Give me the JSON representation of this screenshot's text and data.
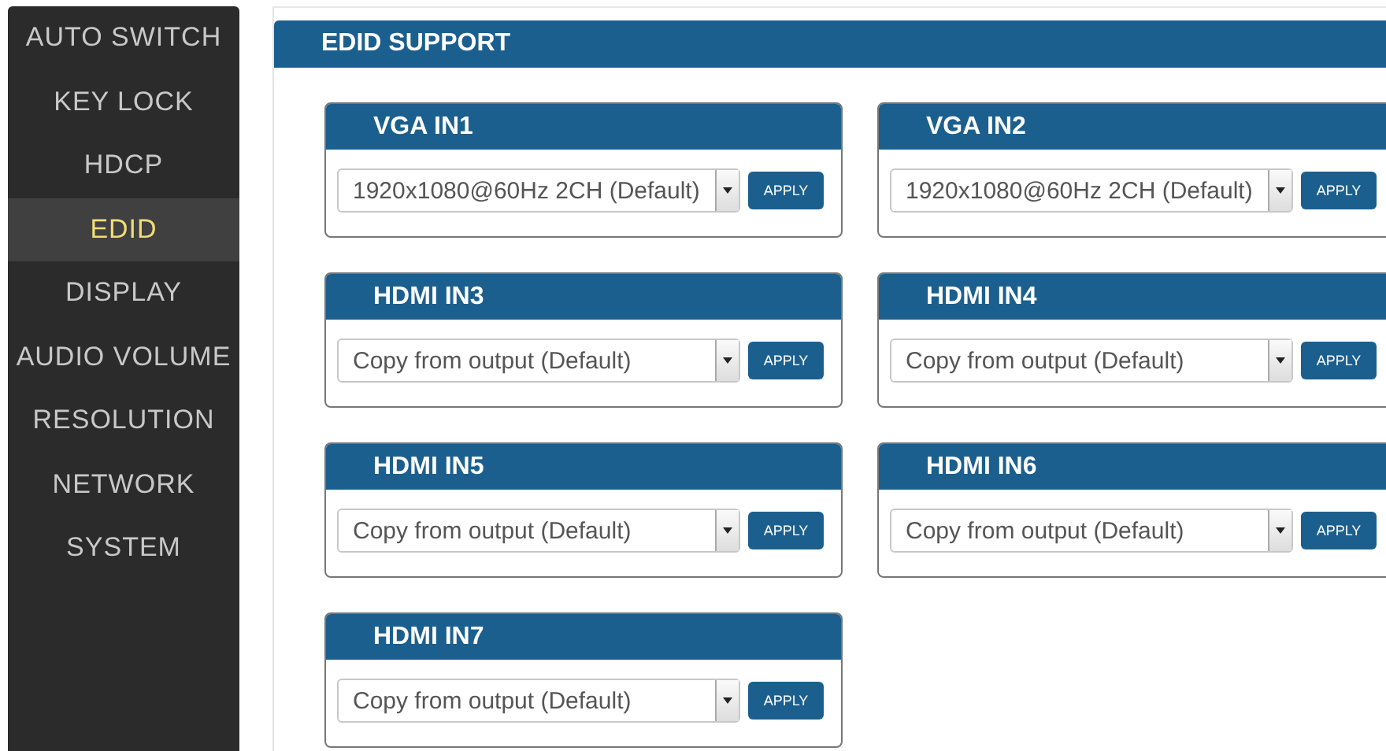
{
  "sidebar": {
    "items": [
      {
        "label": "AUTO SWITCH",
        "selected": false
      },
      {
        "label": "KEY LOCK",
        "selected": false
      },
      {
        "label": "HDCP",
        "selected": false
      },
      {
        "label": "EDID",
        "selected": true
      },
      {
        "label": "DISPLAY",
        "selected": false
      },
      {
        "label": "AUDIO VOLUME",
        "selected": false
      },
      {
        "label": "RESOLUTION",
        "selected": false
      },
      {
        "label": "NETWORK",
        "selected": false
      },
      {
        "label": "SYSTEM",
        "selected": false
      }
    ]
  },
  "panel": {
    "title": "EDID SUPPORT",
    "inputs": [
      {
        "title": "VGA IN1",
        "value": "1920x1080@60Hz 2CH (Default)",
        "button": "APPLY"
      },
      {
        "title": "VGA IN2",
        "value": "1920x1080@60Hz 2CH (Default)",
        "button": "APPLY"
      },
      {
        "title": "HDMI IN3",
        "value": "Copy from output (Default)",
        "button": "APPLY"
      },
      {
        "title": "HDMI IN4",
        "value": "Copy from output (Default)",
        "button": "APPLY"
      },
      {
        "title": "HDMI IN5",
        "value": "Copy from output (Default)",
        "button": "APPLY"
      },
      {
        "title": "HDMI IN6",
        "value": "Copy from output (Default)",
        "button": "APPLY"
      },
      {
        "title": "HDMI IN7",
        "value": "Copy from output (Default)",
        "button": "APPLY"
      }
    ]
  }
}
